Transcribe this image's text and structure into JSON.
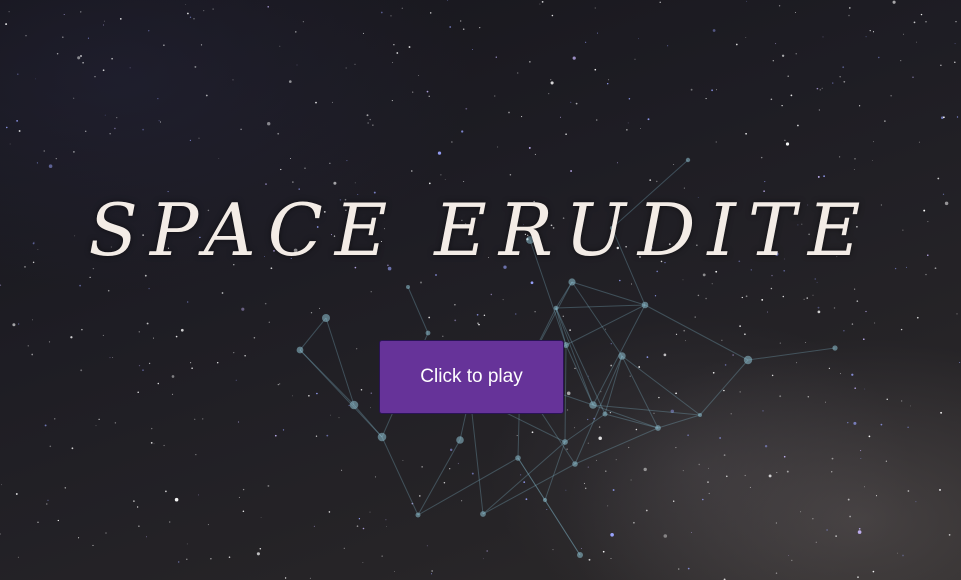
{
  "title": "SPACE ERUDITE",
  "play_button": {
    "label": "Click to play"
  },
  "colors": {
    "button_bg": "#663399",
    "title": "#f3ece6",
    "background": "#1c1b1f"
  }
}
